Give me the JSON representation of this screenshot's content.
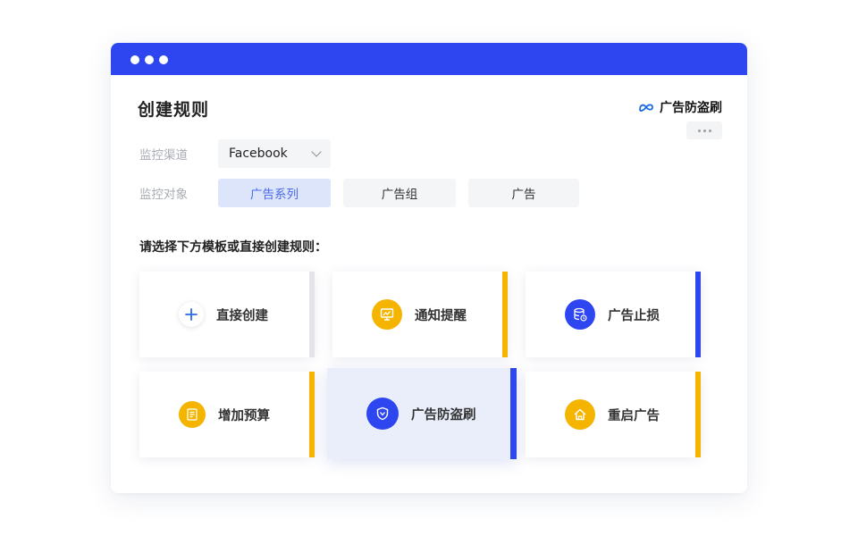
{
  "window": {
    "title": "创建规则",
    "brand": "广告防盗刷",
    "accent": "#2d46f0"
  },
  "form": {
    "channel_label": "监控渠道",
    "channel_value": "Facebook",
    "target_label": "监控对象",
    "targets": [
      "广告系列",
      "广告组",
      "广告"
    ],
    "selected_target": "广告系列"
  },
  "section_title": "请选择下方模板或直接创建规则：",
  "templates": [
    {
      "label": "直接创建",
      "icon": "plus-icon",
      "bar_color": "#e3e4e7"
    },
    {
      "label": "通知提醒",
      "icon": "monitor-chart-icon",
      "bar_color": "#f5b400"
    },
    {
      "label": "广告止损",
      "icon": "database-clock-icon",
      "bar_color": "#2d46f0"
    },
    {
      "label": "增加预算",
      "icon": "document-list-icon",
      "bar_color": "#f5b400"
    },
    {
      "label": "广告防盗刷",
      "icon": "shield-icon",
      "bar_color": "#2d46f0",
      "selected": true
    },
    {
      "label": "重启广告",
      "icon": "home-icon",
      "bar_color": "#f5b400"
    }
  ],
  "colors": {
    "yellow": "#f5b400",
    "blue": "#2d46f0",
    "selected_bg": "#eaeefb"
  }
}
